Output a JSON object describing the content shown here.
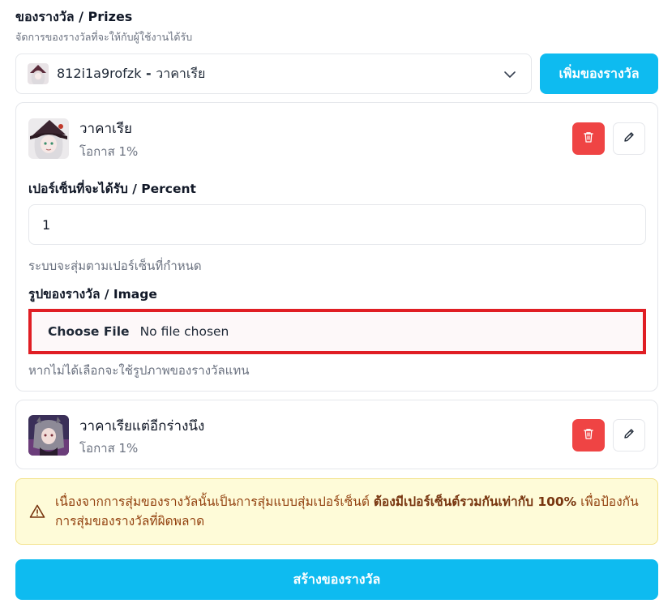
{
  "header": {
    "title": "ของรางวัล / Prizes",
    "subtitle": "จัดการของรางวัลที่จะให้กับผู้ใช้งานได้รับ"
  },
  "selector": {
    "id_text": "812i1a9rofzk",
    "separator": " - ",
    "name_text": "วาคาเรีย",
    "icon": "chevron-down-icon"
  },
  "add_button_label": "เพิ่มของรางวัล",
  "prizes": [
    {
      "name": "วาคาเรีย",
      "chance": "โอกาส 1%",
      "expanded": true,
      "percent_label": "เปอร์เซ็นที่จะได้รับ / Percent",
      "percent_value": "1",
      "percent_hint": "ระบบจะสุ่มตามเปอร์เซ็นที่กำหนด",
      "image_label": "รูปของรางวัล / Image",
      "file_button": "Choose File",
      "file_status": "No file chosen",
      "image_hint": "หากไม่ได้เลือกจะใช้รูปภาพของรางวัลแทน"
    },
    {
      "name": "วาคาเรียแต่อีกร่างนึง",
      "chance": "โอกาส 1%",
      "expanded": false
    }
  ],
  "warning": {
    "text_before": "เนื่องจากการสุ่มของรางวัลนั้นเป็นการสุ่มแบบสุ่มเปอร์เซ็นต์ ",
    "text_bold": "ต้องมีเปอร์เซ็นต์รวมกันเท่ากับ 100%",
    "text_after": " เพื่อป้องกันการสุ่มของรางวัลที่ผิดพลาด",
    "icon": "warning-triangle-icon"
  },
  "create_button_label": "สร้างของรางวัล",
  "colors": {
    "primary": "#0ebbf0",
    "danger": "#ef4444",
    "highlight_border": "#e01e24",
    "warning_bg": "#fefbd8",
    "warning_text": "#92400e"
  }
}
